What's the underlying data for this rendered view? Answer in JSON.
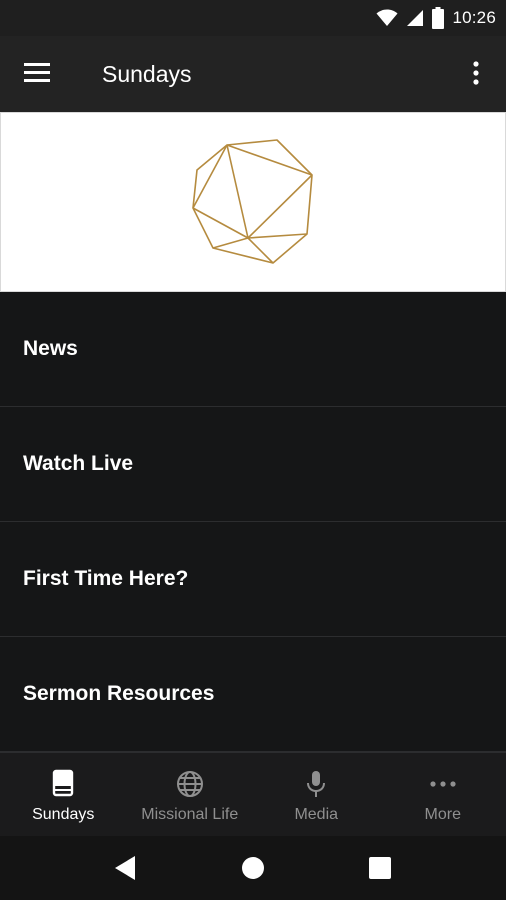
{
  "status_bar": {
    "time": "10:26",
    "icons": [
      "wifi-icon",
      "signal-icon",
      "battery-icon"
    ]
  },
  "app_bar": {
    "title": "Sundays",
    "menu_icon": "hamburger-menu-icon",
    "overflow_icon": "more-vert-icon"
  },
  "banner": {
    "logo": "geometric-polyhedron-logo",
    "accent_color": "#b58b3f"
  },
  "menu": {
    "items": [
      {
        "label": "News"
      },
      {
        "label": "Watch Live"
      },
      {
        "label": "First Time Here?"
      },
      {
        "label": "Sermon Resources"
      }
    ]
  },
  "bottom_nav": {
    "tabs": [
      {
        "label": "Sundays",
        "icon": "book-icon",
        "active": true
      },
      {
        "label": "Missional Life",
        "icon": "globe-icon",
        "active": false
      },
      {
        "label": "Media",
        "icon": "microphone-icon",
        "active": false
      },
      {
        "label": "More",
        "icon": "more-horiz-icon",
        "active": false
      }
    ]
  },
  "system_nav": {
    "buttons": [
      "back-icon",
      "home-icon",
      "recents-icon"
    ]
  },
  "colors": {
    "background": "#151617",
    "app_bar": "#232323",
    "status_bar": "#1f1f1f",
    "inactive_label": "#8f8f8f",
    "active_label": "#ffffff"
  }
}
